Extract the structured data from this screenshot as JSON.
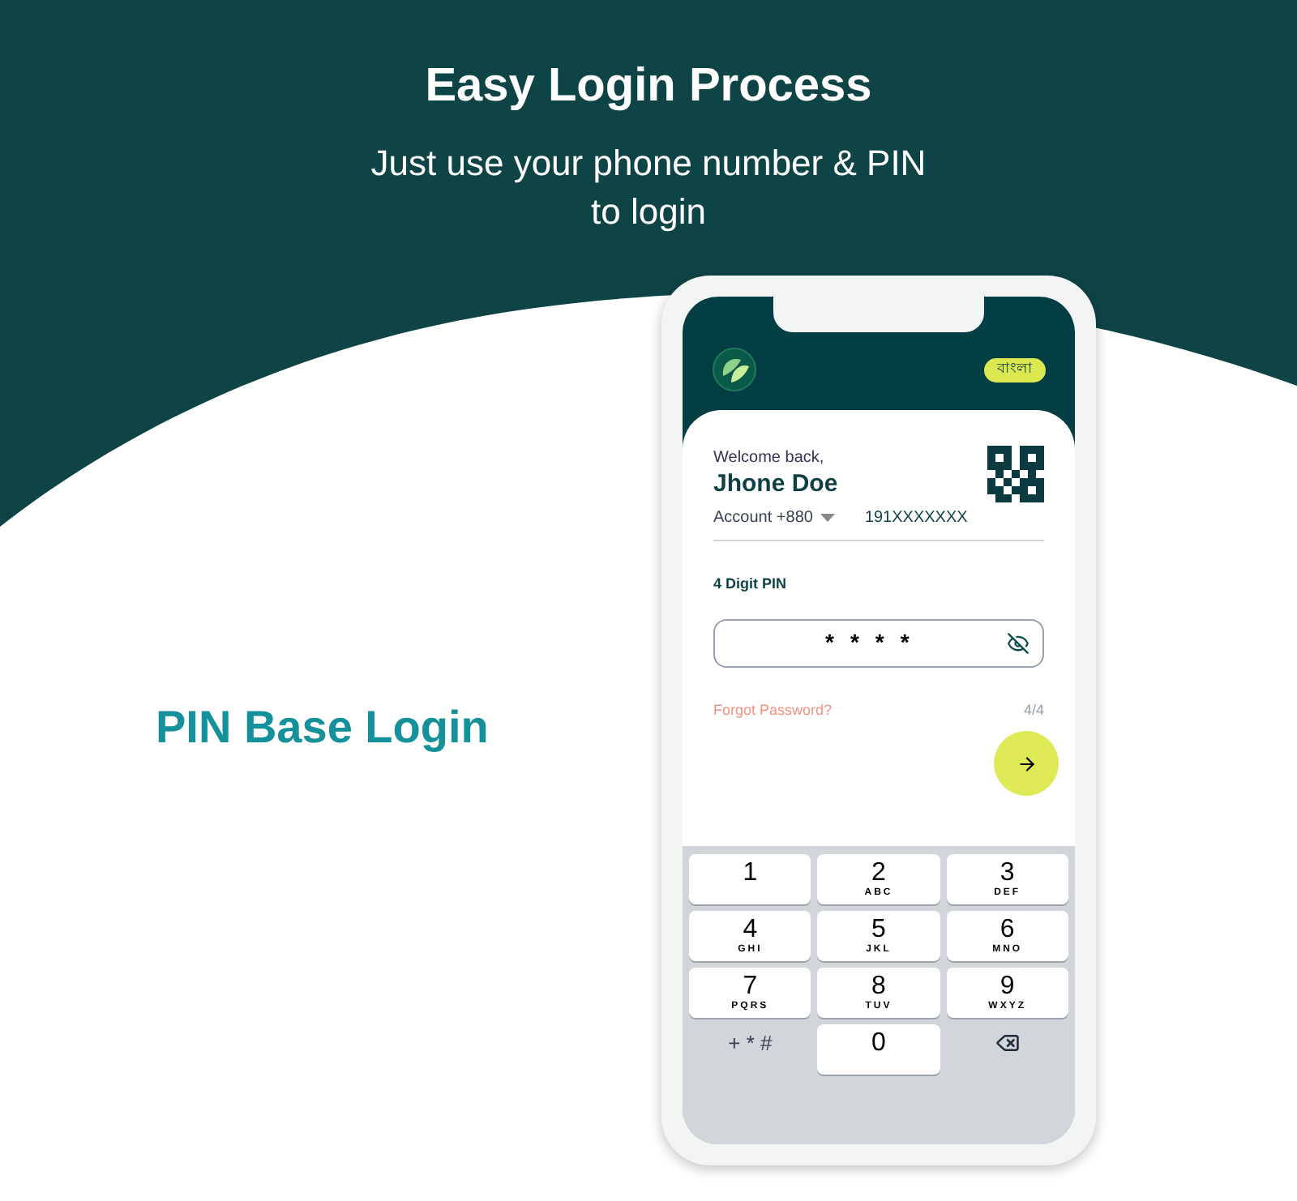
{
  "header": {
    "title": "Easy Login Process",
    "subtitle_lines": [
      "Just use your phone number & PIN",
      "to login"
    ]
  },
  "feature_label": "PIN Base Login",
  "phone": {
    "language_button": "বাংলা",
    "greeting": "Welcome back,",
    "user_name": "Jhone Doe",
    "account_label": "Account +880",
    "phone_number": "191XXXXXXX",
    "pin_label": "4 Digit PIN",
    "pin_value": "****",
    "forgot_link": "Forgot Password?",
    "pin_counter": "4/4",
    "keypad": [
      {
        "kind": "digit",
        "digit": "1"
      },
      {
        "kind": "digit",
        "digit": "2",
        "letters": "ABC"
      },
      {
        "kind": "digit",
        "digit": "3",
        "letters": "DEF"
      },
      {
        "kind": "digit",
        "digit": "4",
        "letters": "GHI"
      },
      {
        "kind": "digit",
        "digit": "5",
        "letters": "JKL"
      },
      {
        "kind": "digit",
        "digit": "6",
        "letters": "MNO"
      },
      {
        "kind": "digit",
        "digit": "7",
        "letters": "PQRS"
      },
      {
        "kind": "digit",
        "digit": "8",
        "letters": "TUV"
      },
      {
        "kind": "digit",
        "digit": "9",
        "letters": "WXYZ"
      },
      {
        "kind": "symbols",
        "label": "+ * #"
      },
      {
        "kind": "digit",
        "digit": "0"
      },
      {
        "kind": "backspace"
      }
    ]
  }
}
